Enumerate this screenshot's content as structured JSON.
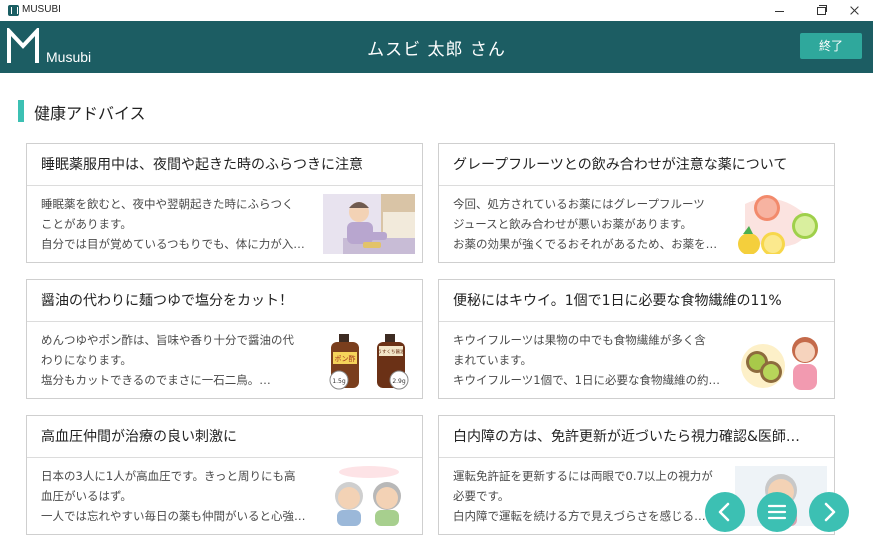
{
  "window": {
    "title": "MUSUBI"
  },
  "header": {
    "brand": "Musubi",
    "user_name": "ムスビ 太郎 さん",
    "end_label": "終了"
  },
  "section": {
    "title": "健康アドバイス"
  },
  "cards": [
    {
      "title": "睡眠薬服用中は、夜間や起きた時のふらつきに注意",
      "lines": [
        "睡眠薬を飲むと、夜中や翌朝起きた時にふらつく",
        "ことがあります。",
        "自分では目が覚めているつもりでも、体に力が入…"
      ]
    },
    {
      "title": "グレープフルーツとの飲み合わせが注意な薬について",
      "lines": [
        "今回、処方されているお薬にはグレープフルーツ",
        "ジュースと飲み合わせが悪いお薬があります。",
        "お薬の効果が強くでるおそれがあるため、お薬を…"
      ]
    },
    {
      "title": "醤油の代わりに麺つゆで塩分をカット！",
      "lines": [
        "めんつゆやポン酢は、旨味や香り十分で醤油の代",
        "わりになります。",
        "塩分もカットできるのでまさに一石二鳥。…"
      ],
      "thumb_labels": {
        "ponzu": "ポン酢",
        "soy": "うすくち醤油",
        "salt1": "1.5g",
        "salt2": "2.9g"
      }
    },
    {
      "title": "便秘にはキウイ。1個で1日に必要な食物繊維の11%",
      "lines": [
        "キウイフルーツは果物の中でも食物繊維が多く含",
        "まれています。",
        "キウイフルーツ1個で、1日に必要な食物繊維の約…"
      ]
    },
    {
      "title": "高血圧仲間が治療の良い刺激に",
      "lines": [
        "日本の3人に1人が高血圧です。きっと周りにも高",
        "血圧がいるはず。",
        "一人では忘れやすい毎日の薬も仲間がいると心強…"
      ]
    },
    {
      "title": "白内障の方は、免許更新が近づいたら視力確認&医師…",
      "lines": [
        "運転免許証を更新するには両眼で0.7以上の視力が",
        "必要です。",
        "白内障で運転を続ける方で見えづらさを感じる…"
      ]
    }
  ],
  "nav": {
    "prev_icon": "chevron-left-icon",
    "menu_icon": "menu-icon",
    "next_icon": "chevron-right-icon"
  },
  "colors": {
    "header": "#1c5d63",
    "accent": "#3cc0b3",
    "button": "#2fa89c"
  }
}
